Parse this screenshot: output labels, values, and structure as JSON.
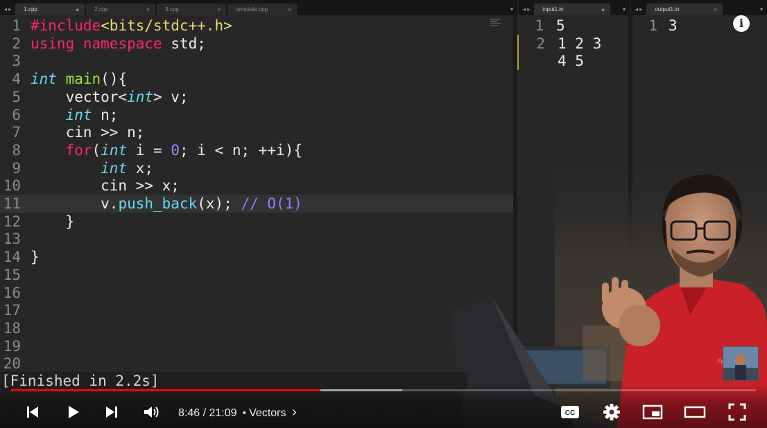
{
  "tabs_main": [
    {
      "label": "1.cpp",
      "active": true,
      "marker": "●"
    },
    {
      "label": "2.cpp",
      "active": false,
      "marker": "×"
    },
    {
      "label": "3.cpp",
      "active": false,
      "marker": "×"
    },
    {
      "label": "template.cpp",
      "active": false,
      "marker": "×"
    }
  ],
  "tabs_input": [
    {
      "label": "input1.in",
      "active": true,
      "marker": "●"
    }
  ],
  "tabs_output": [
    {
      "label": "output1.in",
      "active": true,
      "marker": "×"
    }
  ],
  "nav_arrows": "◂ ▸",
  "dropdown": "▾",
  "editor": {
    "lines": [
      {
        "n": "1",
        "tokens": [
          {
            "t": "#include",
            "c": "kw"
          },
          {
            "t": "<bits/stdc++.h>",
            "c": "str"
          }
        ]
      },
      {
        "n": "2",
        "tokens": [
          {
            "t": "using",
            "c": "kw"
          },
          {
            "t": " ",
            "c": "code"
          },
          {
            "t": "namespace",
            "c": "kw"
          },
          {
            "t": " std;",
            "c": "code"
          }
        ]
      },
      {
        "n": "3",
        "tokens": []
      },
      {
        "n": "4",
        "tokens": [
          {
            "t": "int",
            "c": "ty"
          },
          {
            "t": " ",
            "c": "code"
          },
          {
            "t": "main",
            "c": "fn"
          },
          {
            "t": "(){",
            "c": "code"
          }
        ]
      },
      {
        "n": "5",
        "tokens": [
          {
            "t": "    vector<",
            "c": "code"
          },
          {
            "t": "int",
            "c": "ty"
          },
          {
            "t": "> v;",
            "c": "code"
          }
        ]
      },
      {
        "n": "6",
        "tokens": [
          {
            "t": "    ",
            "c": "code"
          },
          {
            "t": "int",
            "c": "ty"
          },
          {
            "t": " n;",
            "c": "code"
          }
        ]
      },
      {
        "n": "7",
        "tokens": [
          {
            "t": "    cin >> n;",
            "c": "code"
          }
        ]
      },
      {
        "n": "8",
        "tokens": [
          {
            "t": "    ",
            "c": "code"
          },
          {
            "t": "for",
            "c": "kw"
          },
          {
            "t": "(",
            "c": "code"
          },
          {
            "t": "int",
            "c": "ty"
          },
          {
            "t": " i = ",
            "c": "code"
          },
          {
            "t": "0",
            "c": "num"
          },
          {
            "t": "; i < n; ++i){",
            "c": "code"
          }
        ]
      },
      {
        "n": "9",
        "tokens": [
          {
            "t": "        ",
            "c": "code"
          },
          {
            "t": "int",
            "c": "ty"
          },
          {
            "t": " x;",
            "c": "code"
          }
        ]
      },
      {
        "n": "10",
        "tokens": [
          {
            "t": "        cin >> x;",
            "c": "code"
          }
        ]
      },
      {
        "n": "11",
        "tokens": [
          {
            "t": "        v.",
            "c": "code"
          },
          {
            "t": "push_back",
            "c": "ty2"
          },
          {
            "t": "(x); ",
            "c": "code"
          },
          {
            "t": "// O(1)",
            "c": "cm"
          }
        ]
      },
      {
        "n": "12",
        "tokens": [
          {
            "t": "    }",
            "c": "code"
          }
        ]
      },
      {
        "n": "13",
        "tokens": []
      },
      {
        "n": "14",
        "tokens": [
          {
            "t": "}",
            "c": "code"
          }
        ]
      },
      {
        "n": "15",
        "tokens": []
      },
      {
        "n": "16",
        "tokens": []
      },
      {
        "n": "17",
        "tokens": []
      },
      {
        "n": "18",
        "tokens": []
      },
      {
        "n": "19",
        "tokens": []
      },
      {
        "n": "20",
        "tokens": []
      }
    ],
    "current_line": "11"
  },
  "input_file": {
    "lines": [
      {
        "n": "1",
        "text": "5"
      },
      {
        "n": "2",
        "text": "1 2 3"
      },
      {
        "n": "",
        "text": "4 5"
      }
    ]
  },
  "output_file": {
    "lines": [
      {
        "n": "1",
        "text": "3"
      }
    ]
  },
  "console_text": "[Finished in 2.2s]",
  "player": {
    "time_current": "8:46",
    "time_total": "21:09",
    "time_display": "8:46 / 21:09",
    "chapter": "Vectors",
    "chapter_arrow": "›",
    "progress_played": 0.415,
    "progress_buffered": 0.525,
    "cc_label": "CC",
    "info_glyph": "i"
  },
  "colors": {
    "keyword": "#f92672",
    "type": "#66d9ef",
    "function": "#a6e22e",
    "string": "#e6db74",
    "number": "#ae81ff",
    "comment": "#9b7bff",
    "progress_red": "#ff0000"
  }
}
